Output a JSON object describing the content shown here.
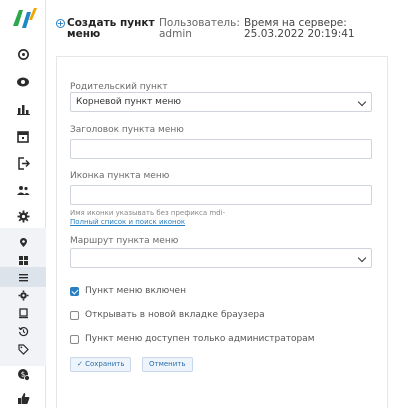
{
  "header": {
    "title_line1": "Создать пункт",
    "title_line2": "меню",
    "user_label": "Пользователь:",
    "user_value": "admin",
    "time_label": "Время на сервере:",
    "time_value": "25.03.2022 20:19:41"
  },
  "sidebar": {
    "icons": [
      "logo-icon",
      "tag-icon",
      "eye-icon",
      "bar-chart-icon",
      "calendar-icon",
      "logout-icon",
      "users-icon",
      "gear-icon",
      "pin-icon",
      "grid-icon",
      "menu-icon",
      "gear-icon",
      "document-icon",
      "history-icon",
      "tag-icon",
      "money-icon",
      "thumbs-up-icon"
    ]
  },
  "form": {
    "parent_label": "Родительский пункт",
    "parent_value": "Корневой пункт меню",
    "title_label": "Заголовок пункта меню",
    "title_value": "",
    "icon_label": "Иконка пункта меню",
    "icon_value": "",
    "icon_hint": "Имя иконки указывать без префикса mdi-",
    "icon_hint_link": "Полный список и поиск иконок",
    "route_label": "Маршрут пункта меню",
    "route_value": "",
    "check_enabled": "Пункт меню включен",
    "check_new_tab": "Открывать в новой вкладке браузера",
    "check_admin_only": "Пункт меню доступен только администраторам",
    "save_label": "✓ Сохранить",
    "cancel_label": "Отменить"
  },
  "colors": {
    "accent": "#2a7fc1",
    "border": "#cfd4da"
  }
}
